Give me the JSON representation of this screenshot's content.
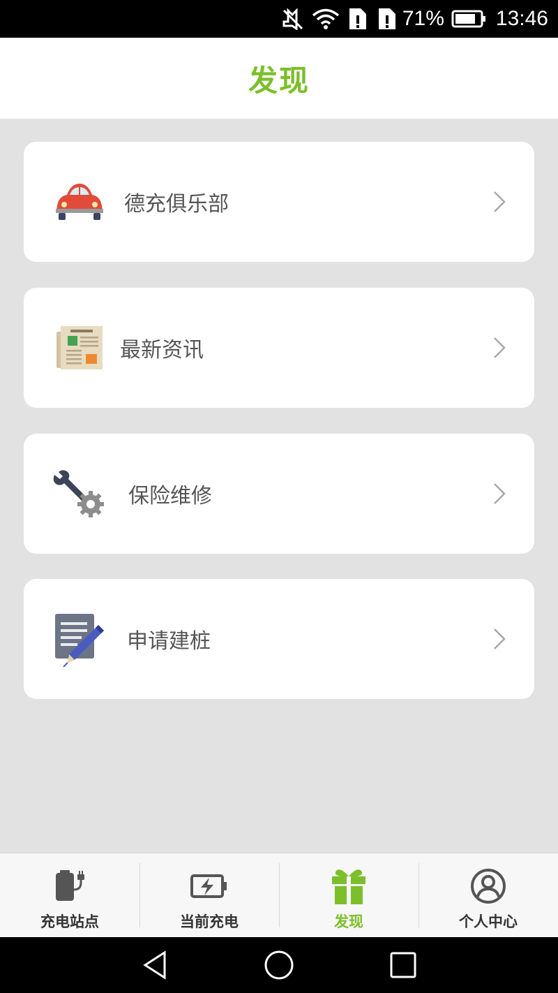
{
  "status_bar": {
    "battery_percent": "71%",
    "time": "13:46",
    "icons": [
      "mute-icon",
      "wifi-icon",
      "sim1-icon",
      "sim2-icon",
      "battery-icon"
    ]
  },
  "header": {
    "title": "发现"
  },
  "menu": [
    {
      "label": "德充俱乐部",
      "icon": "car-icon"
    },
    {
      "label": "最新资讯",
      "icon": "newspaper-icon"
    },
    {
      "label": "保险维修",
      "icon": "wrench-gear-icon"
    },
    {
      "label": "申请建桩",
      "icon": "document-pen-icon"
    }
  ],
  "bottom_nav": [
    {
      "label": "充电站点",
      "icon": "charging-station-icon",
      "active": false
    },
    {
      "label": "当前充电",
      "icon": "battery-charging-icon",
      "active": false
    },
    {
      "label": "发现",
      "icon": "gift-icon",
      "active": true
    },
    {
      "label": "个人中心",
      "icon": "user-icon",
      "active": false
    }
  ],
  "system_nav": [
    "back-icon",
    "home-icon",
    "recents-icon"
  ],
  "colors": {
    "accent": "#7bbf2a",
    "background": "#e2e2e2",
    "card": "#ffffff",
    "text": "#555555"
  }
}
